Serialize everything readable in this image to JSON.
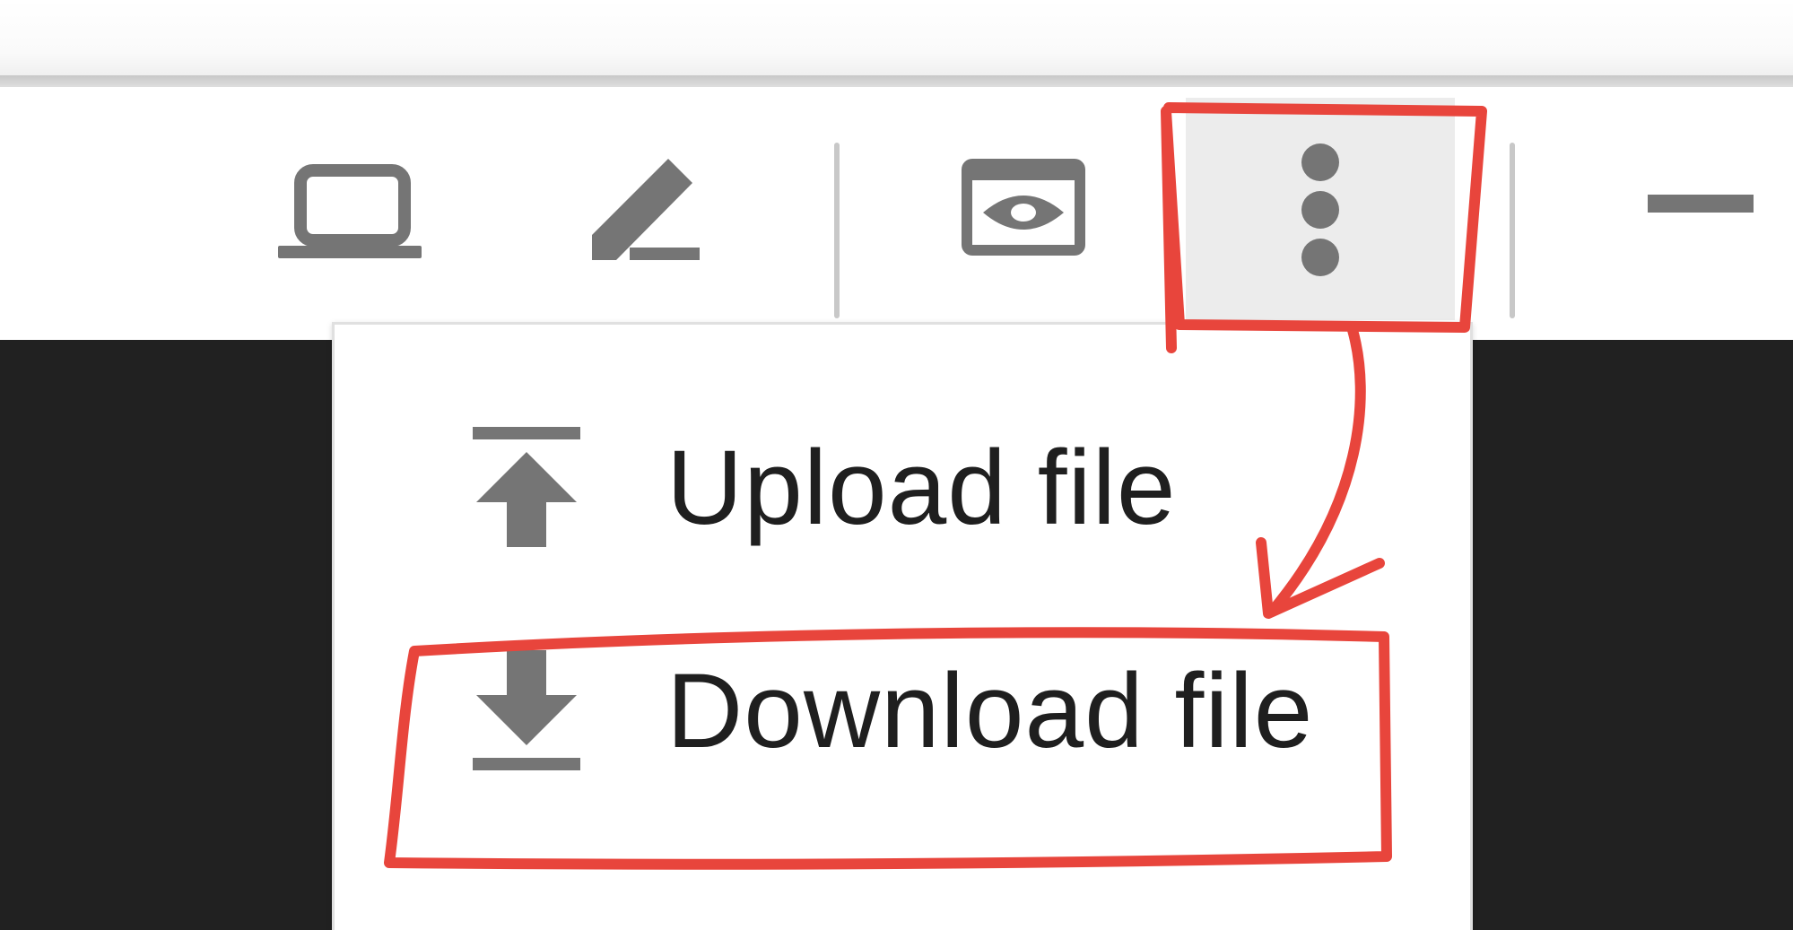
{
  "toolbar": {
    "buttons": [
      {
        "name": "laptop-icon"
      },
      {
        "name": "pencil-icon"
      },
      {
        "name": "eye-icon"
      },
      {
        "name": "more-vert-icon"
      },
      {
        "name": "minimize-icon"
      }
    ]
  },
  "menu": {
    "items": [
      {
        "label": "Upload file",
        "icon": "upload-icon"
      },
      {
        "label": "Download file",
        "icon": "download-icon"
      }
    ]
  },
  "colors": {
    "icon": "#757575",
    "annotation": "#e8453c",
    "dark_background": "#212121",
    "active_button": "#ececec"
  }
}
